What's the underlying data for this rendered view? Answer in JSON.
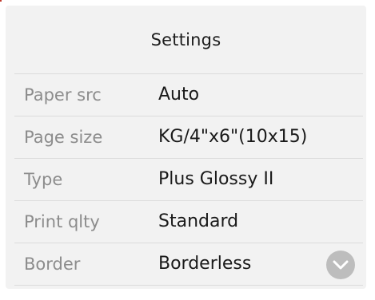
{
  "header": {
    "title": "Settings"
  },
  "settings": [
    {
      "label": "Paper src",
      "value": "Auto"
    },
    {
      "label": "Page size",
      "value": "KG/4\"x6\"(10x15)"
    },
    {
      "label": "Type",
      "value": "Plus Glossy II"
    },
    {
      "label": "Print qlty",
      "value": "Standard"
    },
    {
      "label": "Border",
      "value": "Borderless"
    }
  ],
  "scroll_button": {
    "icon": "chevron-down-icon"
  }
}
